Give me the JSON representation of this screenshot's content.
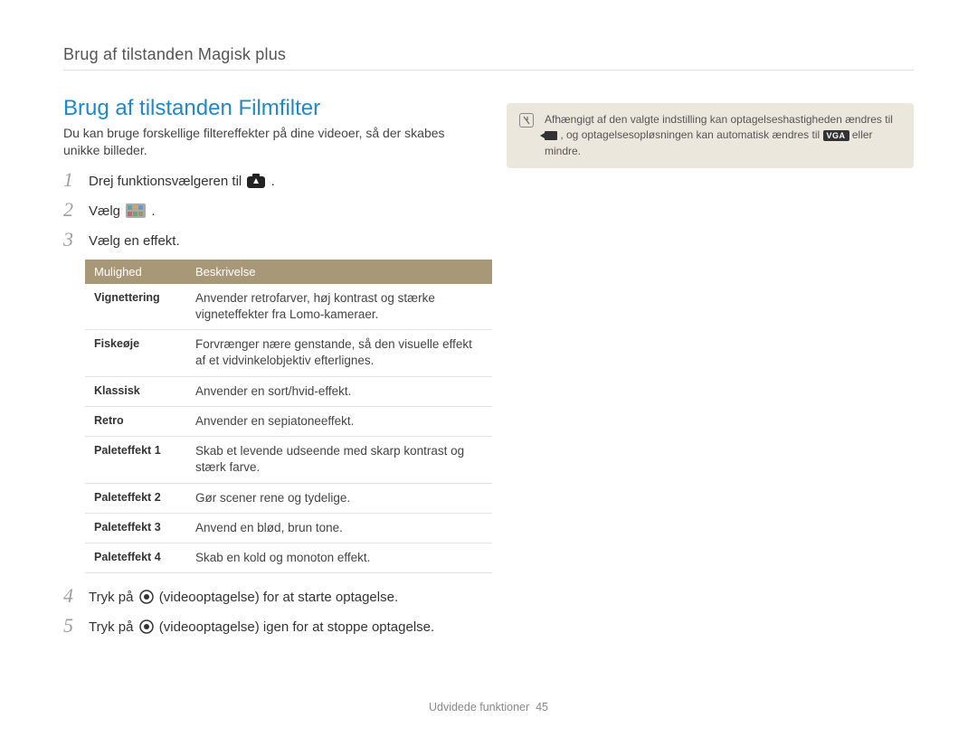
{
  "breadcrumb": "Brug af tilstanden Magisk plus",
  "section_title": "Brug af tilstanden Filmfilter",
  "intro": "Du kan bruge forskellige filtereffekter på dine videoer, så der skabes unikke billeder.",
  "steps": {
    "s1": {
      "num": "1",
      "pre": "Drej funktionsvælgeren til ",
      "post": "."
    },
    "s2": {
      "num": "2",
      "pre": "Vælg ",
      "post": "."
    },
    "s3": {
      "num": "3",
      "text": "Vælg en effekt."
    },
    "s4": {
      "num": "4",
      "pre": "Tryk på ",
      "mid": " (videooptagelse) for at starte optagelse.",
      "post": ""
    },
    "s5": {
      "num": "5",
      "pre": "Tryk på ",
      "mid": " (videooptagelse) igen for at stoppe optagelse.",
      "post": ""
    }
  },
  "table": {
    "head_option": "Mulighed",
    "head_desc": "Beskrivelse",
    "rows": [
      {
        "name": "Vignettering",
        "desc": "Anvender retrofarver, høj kontrast og stærke vigneteffekter fra Lomo-kameraer."
      },
      {
        "name": "Fiskeøje",
        "desc": "Forvrænger nære genstande, så den visuelle effekt af et vidvinkelobjektiv efterlignes."
      },
      {
        "name": "Klassisk",
        "desc": "Anvender en sort/hvid-effekt."
      },
      {
        "name": "Retro",
        "desc": "Anvender en sepiatoneeffekt."
      },
      {
        "name": "Paleteffekt 1",
        "desc": "Skab et levende udseende med skarp kontrast og stærk farve."
      },
      {
        "name": "Paleteffekt 2",
        "desc": "Gør scener rene og tydelige."
      },
      {
        "name": "Paleteffekt 3",
        "desc": "Anvend en blød, brun tone."
      },
      {
        "name": "Paleteffekt 4",
        "desc": "Skab en kold og monoton effekt."
      }
    ]
  },
  "note": {
    "line1_pre": "Afhængigt af den valgte indstilling kan optagelseshastigheden ændres til ",
    "line1_post": ", og optagelsesopløsningen kan automatisk ændres til ",
    "line1_end": " eller mindre.",
    "vga_label": "VGA"
  },
  "footer": {
    "section": "Udvidede funktioner",
    "page": "45"
  }
}
